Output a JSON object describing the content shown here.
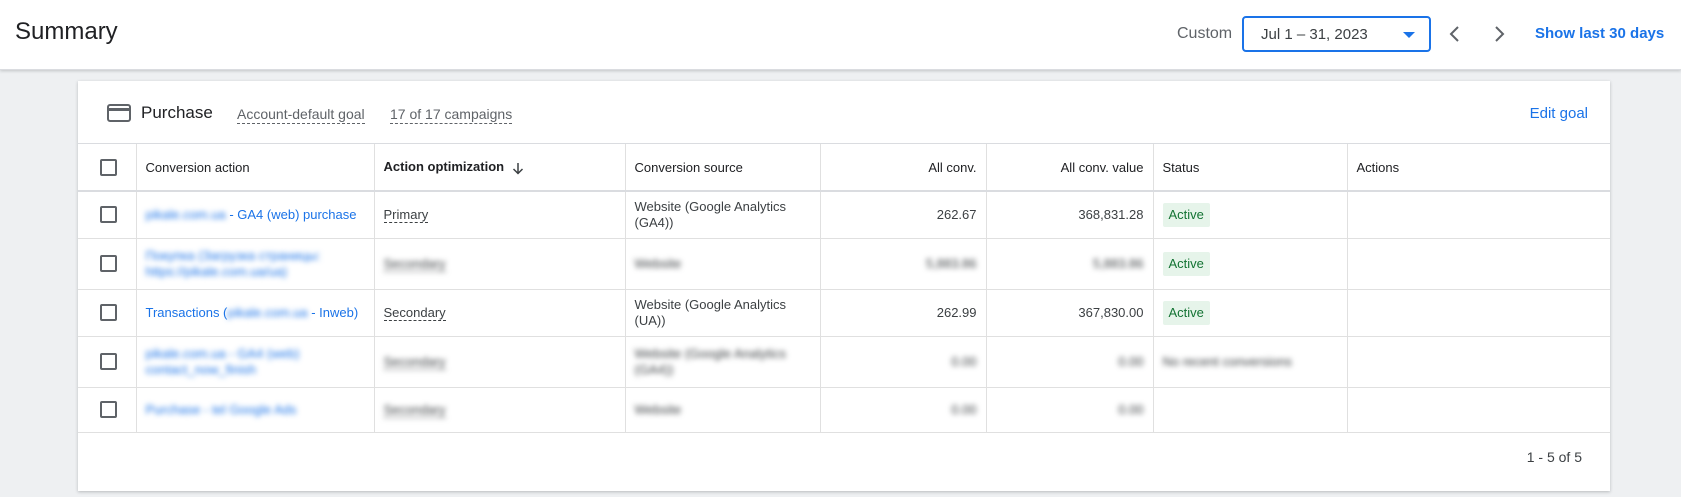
{
  "header": {
    "title": "Summary",
    "custom_label": "Custom",
    "date_range": "Jul 1 – 31, 2023",
    "show_last": "Show last 30 days"
  },
  "goal": {
    "title": "Purchase",
    "account_default": "Account-default goal",
    "campaigns": "17 of 17 campaigns",
    "edit": "Edit goal"
  },
  "table": {
    "columns": {
      "conversion_action": "Conversion action",
      "action_optimization": "Action optimization",
      "conversion_source": "Conversion source",
      "all_conv": "All conv.",
      "all_conv_value": "All conv. value",
      "status": "Status",
      "actions": "Actions"
    },
    "rows": [
      {
        "action_prefix": "pikale.com.ua",
        "action": " - GA4 (web) purchase",
        "optimization": "Primary",
        "source": "Website (Google Analytics (GA4))",
        "all_conv": "262.67",
        "all_conv_value": "368,831.28",
        "status": "Active"
      },
      {
        "action": "Покупка (Загрузка страницы: https://pikale.com.ua/ua)",
        "optimization": "Secondary",
        "source": "Website",
        "all_conv": "5,883.86",
        "all_conv_value": "5,883.86",
        "status": "Active"
      },
      {
        "action_start": "Transactions (",
        "action_prefix": "pikale.com.ua",
        "action_end": " - Inweb)",
        "optimization": "Secondary",
        "source": "Website (Google Analytics (UA))",
        "all_conv": "262.99",
        "all_conv_value": "367,830.00",
        "status": "Active"
      },
      {
        "action": "pikale.com.ua - GA4 (web) contact_now_finish",
        "optimization": "Secondary",
        "source": "Website (Google Analytics (GA4))",
        "all_conv": "0.00",
        "all_conv_value": "0.00",
        "status": "No recent conversions"
      },
      {
        "action": "Purchase - tel Google Ads",
        "optimization": "Secondary",
        "source": "Website",
        "all_conv": "0.00",
        "all_conv_value": "0.00",
        "status": ""
      }
    ]
  },
  "pagination": "1 - 5 of 5"
}
